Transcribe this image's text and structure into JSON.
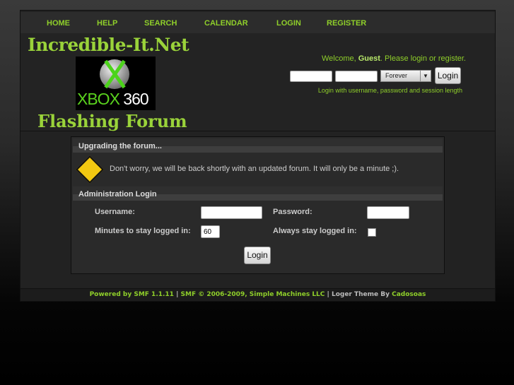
{
  "nav": {
    "items": [
      "HOME",
      "HELP",
      "SEARCH",
      "CALENDAR",
      "LOGIN",
      "REGISTER"
    ]
  },
  "header": {
    "logo_top": "Incredible-It.Net",
    "logo_image": "XBOX 360",
    "logo_bottom": "Flashing Forum",
    "welcome_prefix": "Welcome, ",
    "welcome_user": "Guest",
    "welcome_suffix": ". Please login or register.",
    "session_select": "Forever",
    "login_button": "Login",
    "hint": "Login with username, password and session length"
  },
  "maintenance": {
    "title": "Upgrading the forum...",
    "message": "Don't worry, we will be back shortly with an updated forum. It will only be a minute ;).",
    "icon": "construction-sign-icon"
  },
  "admin_login": {
    "title": "Administration Login",
    "username_label": "Username:",
    "password_label": "Password:",
    "minutes_label": "Minutes to stay logged in:",
    "minutes_value": "60",
    "always_label": "Always stay logged in:",
    "login_button": "Login"
  },
  "footer": {
    "powered": "Powered by SMF 1.1.11",
    "sep1": " | ",
    "smf": "SMF © 2006-2009, Simple Machines LLC",
    "sep2": " | Loger Theme By ",
    "author": "Cadosoas"
  },
  "colors": {
    "accent": "#8fcf2a"
  }
}
